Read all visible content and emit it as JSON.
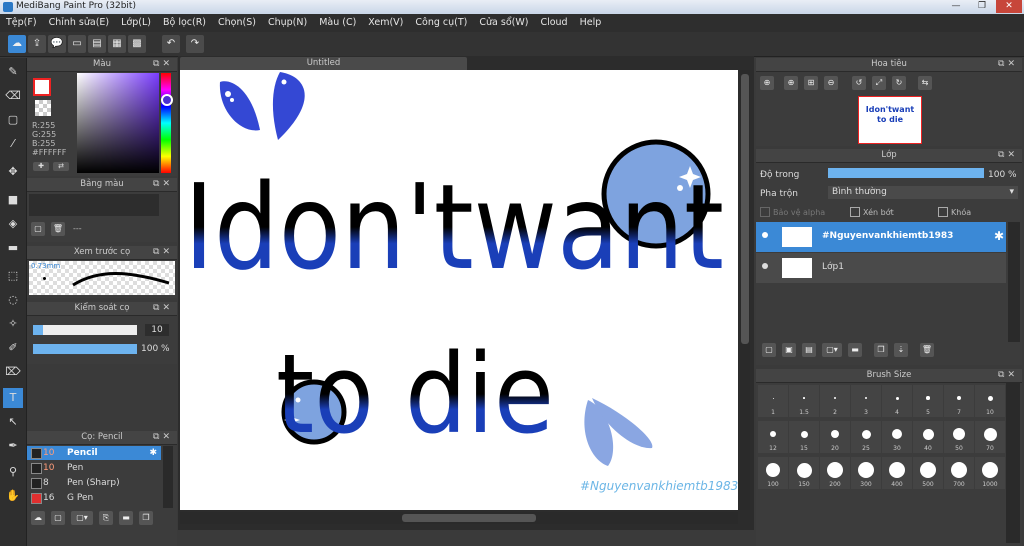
{
  "window": {
    "title": "MediBang Paint Pro (32bit)",
    "minimize": "—",
    "maximize": "❐",
    "close": "✕"
  },
  "menu": [
    "Tệp(F)",
    "Chỉnh sửa(E)",
    "Lớp(L)",
    "Bộ lọc(R)",
    "Chọn(S)",
    "Chụp(N)",
    "Màu (C)",
    "Xem(V)",
    "Công cụ(T)",
    "Cửa sổ(W)",
    "Cloud",
    "Help"
  ],
  "color_panel": {
    "title": "Màu",
    "r": "R:255",
    "g": "G:255",
    "b": "B:255",
    "hex": "#FFFFFF"
  },
  "palette_panel": {
    "title": "Bảng màu",
    "value": "---"
  },
  "brush_preview": {
    "title": "Xem trước cọ",
    "size": "0.73mm"
  },
  "brush_control": {
    "title": "Kiểm soát cọ",
    "size_value": "10",
    "opacity_value": "100 %",
    "size_fraction": 0.1,
    "opacity_fraction": 1.0
  },
  "brush_list": {
    "title": "Cọ: Pencil",
    "items": [
      {
        "size": "10",
        "name": "Pencil",
        "color": "#222222",
        "selected": true
      },
      {
        "size": "10",
        "name": "Pen",
        "color": "#222222",
        "selected": false
      },
      {
        "size": "8",
        "name": "Pen (Sharp)",
        "color": "#222222",
        "selected": false
      },
      {
        "size": "16",
        "name": "G Pen",
        "color": "#e03030",
        "selected": false
      }
    ]
  },
  "canvas": {
    "tab": "Untitled",
    "text_line1": "Idon'twant",
    "text_line2": "to die",
    "signature": "#Nguyenvankhiemtb1983"
  },
  "navigator": {
    "title": "Hoa tiêu",
    "thumb_line1": "Idon'twant",
    "thumb_line2": "to die"
  },
  "layer_panel": {
    "title": "Lớp",
    "opacity_label": "Độ trong",
    "opacity_value": "100 %",
    "opacity_fraction": 1.0,
    "blend_label": "Pha trộn",
    "blend_value": "Bình thường",
    "protect_alpha": "Bảo vệ alpha",
    "clipping": "Xén bớt",
    "lock": "Khóa",
    "layers": [
      {
        "name": "#Nguyenvankhiemtb1983",
        "selected": true
      },
      {
        "name": "Lớp1",
        "selected": false
      }
    ]
  },
  "brush_size_panel": {
    "title": "Brush Size",
    "sizes": [
      "1",
      "1.5",
      "2",
      "3",
      "4",
      "5",
      "7",
      "10",
      "12",
      "15",
      "20",
      "25",
      "30",
      "40",
      "50",
      "70",
      "100",
      "150",
      "200",
      "300",
      "400",
      "500",
      "700",
      "1000"
    ]
  },
  "colors": {
    "accent": "#3b89d6",
    "text_blue": "#1a3fb8",
    "circle_blue": "#7ea3df",
    "petal_blue": "#3448d4",
    "signature": "#6cb6e6"
  }
}
